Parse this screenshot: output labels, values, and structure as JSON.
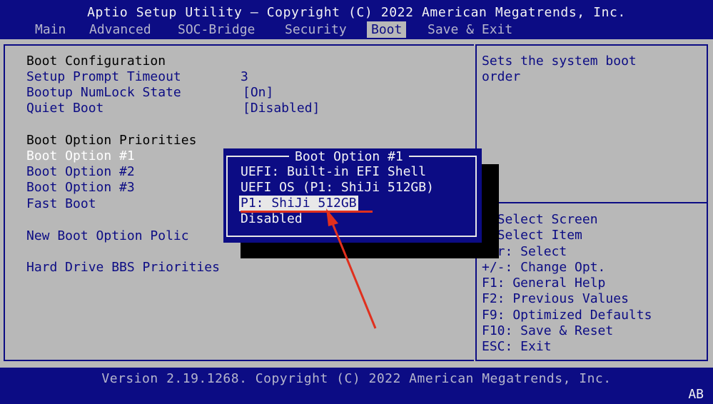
{
  "window": {
    "title": "Aptio Setup Utility – Copyright (C) 2022 American Megatrends, Inc."
  },
  "tabs": [
    {
      "label": "Main"
    },
    {
      "label": "Advanced"
    },
    {
      "label": "SOC-Bridge"
    },
    {
      "label": "Security"
    },
    {
      "label": "Boot"
    },
    {
      "label": "Save & Exit"
    }
  ],
  "active_tab": "Boot",
  "settings": {
    "boot_config_heading": "Boot Configuration",
    "setup_prompt_timeout": {
      "label": "Setup Prompt Timeout",
      "value": "3"
    },
    "bootup_numlock": {
      "label": "Bootup NumLock State",
      "value": "[On]"
    },
    "quiet_boot": {
      "label": "Quiet Boot",
      "value": "[Disabled]"
    },
    "boot_priorities_heading": "Boot Option Priorities",
    "boot_option_1": "Boot Option #1",
    "boot_option_2": "Boot Option #2",
    "boot_option_3": "Boot Option #3",
    "fast_boot": "Fast Boot",
    "new_boot_option_policy": "New Boot Option Polic",
    "hard_drive_bbs": "Hard Drive BBS Priorities"
  },
  "help": {
    "description": "Sets the system boot\norder",
    "keys": [
      ": Select Screen",
      ": Select Item",
      "ter: Select",
      "+/-: Change Opt.",
      "F1: General Help",
      "F2: Previous Values",
      "F9: Optimized Defaults",
      "F10: Save & Reset",
      "ESC: Exit"
    ]
  },
  "popup": {
    "title": "Boot Option #1",
    "options": [
      "UEFI: Built-in EFI Shell",
      "UEFI OS (P1: ShiJi 512GB)",
      "P1: ShiJi 512GB",
      "Disabled"
    ],
    "selected_index": 2
  },
  "annotation": {
    "color": "#e0301e"
  },
  "footer": {
    "version": "Version 2.19.1268. Copyright (C) 2022 American Megatrends, Inc.",
    "indicator": "AB"
  }
}
